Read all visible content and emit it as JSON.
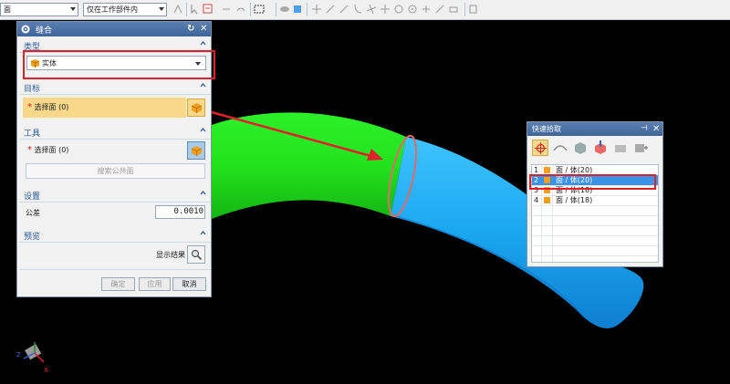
{
  "toolbar": {
    "filter_value": "面",
    "scope_value": "仅在工作部件内"
  },
  "stitch_dialog": {
    "title": "缝合",
    "type_section": "类型",
    "type_value": "实体",
    "target_section": "目标",
    "target_select": "选择面 (0)",
    "tool_section": "工具",
    "tool_select": "选择面 (0)",
    "search_button": "搜索公共面",
    "settings_section": "设置",
    "tolerance_label": "公差",
    "tolerance_value": "0.0010",
    "preview_section": "预览",
    "show_result_label": "显示结果",
    "ok_button": "确定",
    "apply_button": "应用",
    "cancel_button": "取消",
    "required_mark": "*"
  },
  "quick_pick": {
    "title": "快速拾取",
    "items": [
      {
        "index": "1",
        "label": "面 / 体(20)"
      },
      {
        "index": "2",
        "label": "面 / 体(20)"
      },
      {
        "index": "3",
        "label": "面 / 体(18)"
      },
      {
        "index": "4",
        "label": "面 / 体(18)"
      }
    ],
    "selected_index": 1
  },
  "colors": {
    "highlight_box": "#e0202a",
    "green_body": "#22e61e",
    "blue_body": "#1aa6f0",
    "selection_blue": "#3a93e6",
    "title_bar": "#4a6fa5",
    "section_text": "#2d5aa0"
  },
  "icons": [
    "gear-icon",
    "refresh-icon",
    "close-icon",
    "solid-body-icon",
    "pick-face-icon",
    "magnifier-icon",
    "pin-icon",
    "crosshair-icon"
  ]
}
